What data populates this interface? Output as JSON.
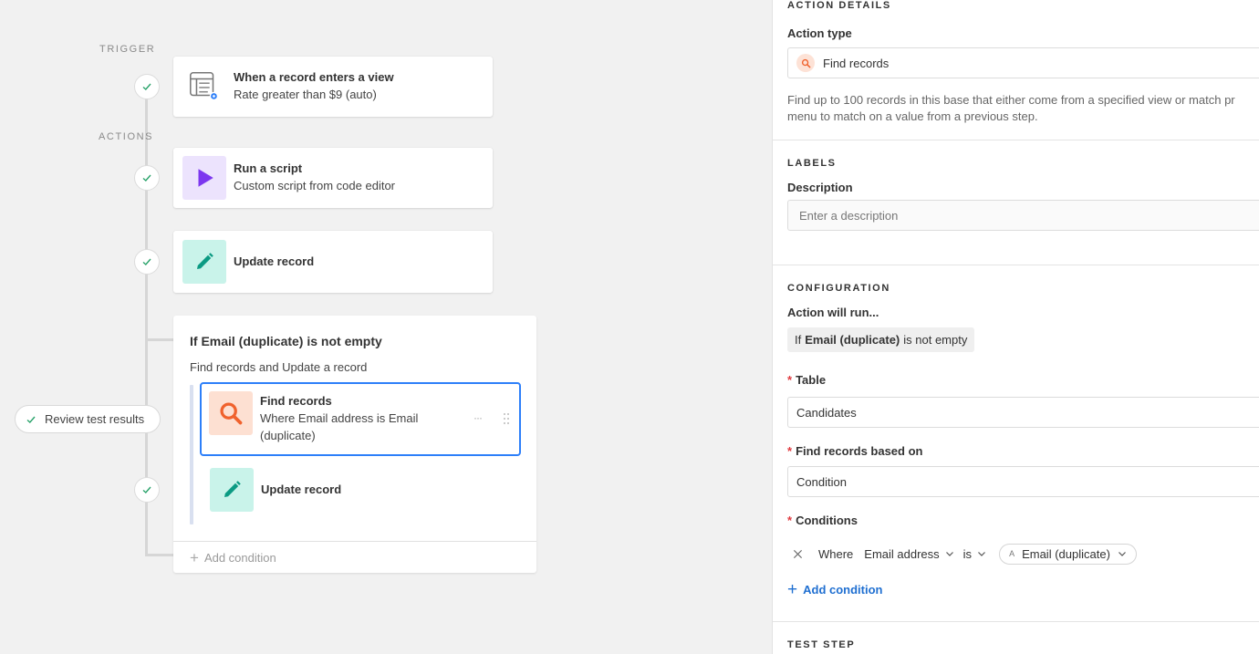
{
  "canvas": {
    "trigger_label": "TRIGGER",
    "actions_label": "ACTIONS",
    "trigger_card": {
      "title": "When a record enters a view",
      "subtitle": "Rate greater than $9 (auto)",
      "icon": "table-view-icon"
    },
    "action_cards": [
      {
        "title": "Run a script",
        "subtitle": "Custom script from code editor",
        "icon": "play-icon",
        "icon_bg": "#ece3fd",
        "icon_color": "#7c37ef"
      },
      {
        "title": "Update record",
        "subtitle": "",
        "icon": "pencil-icon",
        "icon_bg": "#c9f3ea",
        "icon_color": "#0b9a83"
      }
    ],
    "condition_group": {
      "title": "If Email (duplicate) is not empty",
      "subtitle": "Find records and Update a record",
      "steps": [
        {
          "title": "Find records",
          "subtitle": "Where Email address is Email (duplicate)",
          "icon": "search-icon",
          "icon_bg": "#fde0d2",
          "icon_color": "#f0622d",
          "selected": true,
          "more": "···"
        },
        {
          "title": "Update record",
          "subtitle": "",
          "icon": "pencil-icon",
          "icon_bg": "#c9f3ea",
          "icon_color": "#0b9a83",
          "selected": false
        }
      ],
      "add_condition": "Add condition"
    },
    "review_pill": "Review test results"
  },
  "panel": {
    "action_details_header": "ACTION DETAILS",
    "action_type_label": "Action type",
    "action_type_value": "Find records",
    "action_description": "Find up to 100 records in this base that either come from a specified view or match pr",
    "action_description_2": "menu to match on a value from a previous step.",
    "labels_header": "LABELS",
    "description_label": "Description",
    "description_placeholder": "Enter a description",
    "configuration_header": "CONFIGURATION",
    "action_will_run_label": "Action will run...",
    "run_condition": {
      "prefix": "If",
      "field": "Email (duplicate)",
      "suffix": "is not empty"
    },
    "table_label": "Table",
    "table_value": "Candidates",
    "based_on_label": "Find records based on",
    "based_on_value": "Condition",
    "conditions_label": "Conditions",
    "condition": {
      "where": "Where",
      "field": "Email address",
      "operator": "is",
      "value": "Email (duplicate)",
      "value_type_glyph": "A"
    },
    "add_condition": "Add condition",
    "test_step_header": "TEST STEP",
    "accent": "#2d7ff9",
    "required_color": "#e0393e"
  }
}
